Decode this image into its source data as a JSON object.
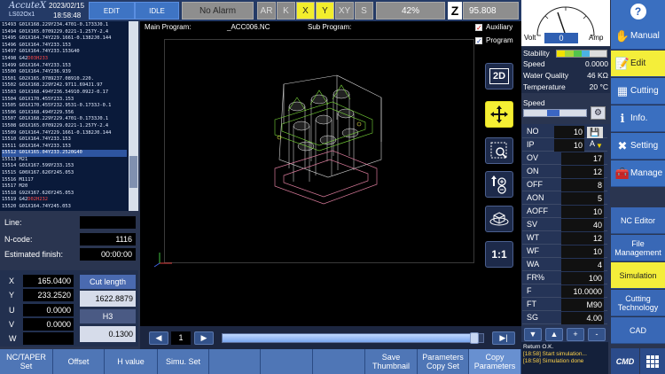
{
  "header": {
    "brand": "AccuteX",
    "model": "LS02Ox1",
    "date": "2023/02/15",
    "time": "18:58:48",
    "edit_label": "EDIT",
    "idle_label": "IDLE",
    "alarm_label": "No Alarm",
    "axis_buttons": [
      "AR",
      "K",
      "X",
      "Y",
      "XY",
      "S"
    ],
    "axis_active": [
      "X",
      "Y"
    ],
    "percent": "42%",
    "z_icon": "Z",
    "z_value": "95.808"
  },
  "code_lines": [
    {
      "n": "15493",
      "t": "G01X168.229Y234.4701-0.1733J0.1",
      "hl": false
    },
    {
      "n": "15494",
      "t": "G01X165.0709229.0221-1.257Y-2.4",
      "hl": false
    },
    {
      "n": "15495",
      "t": "G01X164.74Y229.1661-0.1382J0.144",
      "hl": false
    },
    {
      "n": "15496",
      "t": "G01X164.74Y233.153",
      "hl": false
    },
    {
      "n": "15497",
      "t": "G01X164.74Y233.153G40",
      "hl": false
    },
    {
      "n": "15498",
      "t": "G42",
      "r": "D03H233",
      "hl": false
    },
    {
      "n": "15499",
      "t": "G01X164.74Y233.153",
      "hl": false
    },
    {
      "n": "15500",
      "t": "G01X164.74Y236.939",
      "hl": false
    },
    {
      "n": "15501",
      "t": "G02X165.0789237.08910.220.",
      "hl": false
    },
    {
      "n": "15502",
      "t": "G01X168.229Y242.9711.694J1.97",
      "hl": false
    },
    {
      "n": "15503",
      "t": "G01X168.494Y236.54910.092J-0.17",
      "hl": false
    },
    {
      "n": "15504",
      "t": "G01X170.455Y233.153",
      "hl": false
    },
    {
      "n": "15505",
      "t": "G01X170.455Y232.9531-0.1733J-0.1",
      "hl": false
    },
    {
      "n": "15506",
      "t": "G01X168.494Y229.556",
      "hl": false
    },
    {
      "n": "15507",
      "t": "G01X168.229Y229.4701-0.1733J0.1",
      "hl": false
    },
    {
      "n": "15508",
      "t": "G01X165.0709229.0221-1.257Y-2.4",
      "hl": false
    },
    {
      "n": "15509",
      "t": "G01X164.74Y229.1661-0.1382J0.144",
      "hl": false
    },
    {
      "n": "15510",
      "t": "G01X164.74Y233.153",
      "hl": false
    },
    {
      "n": "15511",
      "t": "G01X164.74Y233.153",
      "hl": false
    },
    {
      "n": "15512",
      "t": "G01X165.04Y233.2520G40",
      "hl": true
    },
    {
      "n": "15513",
      "t": "M21",
      "hl": false
    },
    {
      "n": "15514",
      "t": "G01X167.599Y233.153",
      "hl": false
    },
    {
      "n": "15515",
      "t": "G00X167.626Y245.053",
      "hl": false
    },
    {
      "n": "15516",
      "t": "M1117",
      "hl": false
    },
    {
      "n": "15517",
      "t": "M20",
      "hl": false
    },
    {
      "n": "15518",
      "t": "G92X167.626Y245.053",
      "hl": false
    },
    {
      "n": "15519",
      "t": "G42",
      "r": "D02H232",
      "hl": false
    },
    {
      "n": "15520",
      "t": "G01X164.74Y245.053",
      "hl": false
    },
    {
      "n": "15521",
      "t": "G01X164.74Y248.053",
      "hl": false
    }
  ],
  "info": {
    "line_label": "Line:",
    "line_value": "",
    "ncode_label": "N-code:",
    "ncode_value": "1116",
    "finish_label": "Estimated finish:",
    "finish_value": "00:00:00"
  },
  "coords": [
    {
      "axis": "X",
      "value": "165.0400"
    },
    {
      "axis": "Y",
      "value": "233.2520"
    },
    {
      "axis": "U",
      "value": "0.0000"
    },
    {
      "axis": "V",
      "value": "0.0000"
    },
    {
      "axis": "W",
      "value": ""
    }
  ],
  "cut": {
    "label": "Cut length",
    "value": "1622.8879",
    "h_label": "H3",
    "h_value": "0.1300"
  },
  "sim": {
    "main_program_label": "Main Program:",
    "main_program": "_ACC006.NC",
    "sub_program_label": "Sub Program:",
    "auxiliary_label": "Auxiliary",
    "program_label": "Program",
    "page": "1",
    "tool_2d": "2D",
    "tool_11": "1:1"
  },
  "gauge": {
    "volt_label": "Volt",
    "value": "0",
    "amp_label": "Amp"
  },
  "status": [
    {
      "k": "Stability",
      "v": ""
    },
    {
      "k": "Speed",
      "v": "0.0000"
    },
    {
      "k": "Water Quality",
      "v": "46 KΩ"
    },
    {
      "k": "Temperature",
      "v": "20 °C"
    }
  ],
  "speed_label": "Speed",
  "registers": [
    {
      "k": "NO",
      "v": "10"
    },
    {
      "k": "IP",
      "v": "10",
      "extra": "A"
    },
    {
      "k": "OV",
      "v": "17"
    },
    {
      "k": "ON",
      "v": "12"
    },
    {
      "k": "OFF",
      "v": "8"
    },
    {
      "k": "AON",
      "v": "5"
    },
    {
      "k": "AOFF",
      "v": "10"
    },
    {
      "k": "SV",
      "v": "40"
    },
    {
      "k": "WT",
      "v": "12"
    },
    {
      "k": "WF",
      "v": "10"
    },
    {
      "k": "WA",
      "v": "4"
    },
    {
      "k": "FR%",
      "v": "100"
    },
    {
      "k": "F",
      "v": "10.0000"
    },
    {
      "k": "FT",
      "v": "M90"
    },
    {
      "k": "SG",
      "v": "4.00"
    }
  ],
  "log": {
    "line1": "Return O.K.",
    "line2": "[18:58] Start simulation...",
    "line3": "[18:58] Simulation done"
  },
  "nav": [
    {
      "label": "Manual",
      "icon": "hand-icon"
    },
    {
      "label": "Edit",
      "icon": "edit-icon"
    },
    {
      "label": "Cutting",
      "icon": "cutting-icon"
    },
    {
      "label": "Info.",
      "icon": "info-icon"
    },
    {
      "label": "Setting",
      "icon": "setting-icon"
    },
    {
      "label": "Manage",
      "icon": "manage-icon"
    }
  ],
  "subnav": [
    "NC Editor",
    "File Management",
    "Simulation",
    "Cutting Technology",
    "CAD"
  ],
  "bottom": [
    "NC/TAPER Set",
    "Offset",
    "H value",
    "Simu. Set",
    "Save Thumbnail",
    "Parameters Copy Set",
    "Copy Parameters"
  ],
  "cmd_label": "CMD",
  "help_label": "?",
  "colors": {
    "accent": "#3e74c4",
    "active": "#f4ee3a",
    "background": "#2a3550"
  }
}
